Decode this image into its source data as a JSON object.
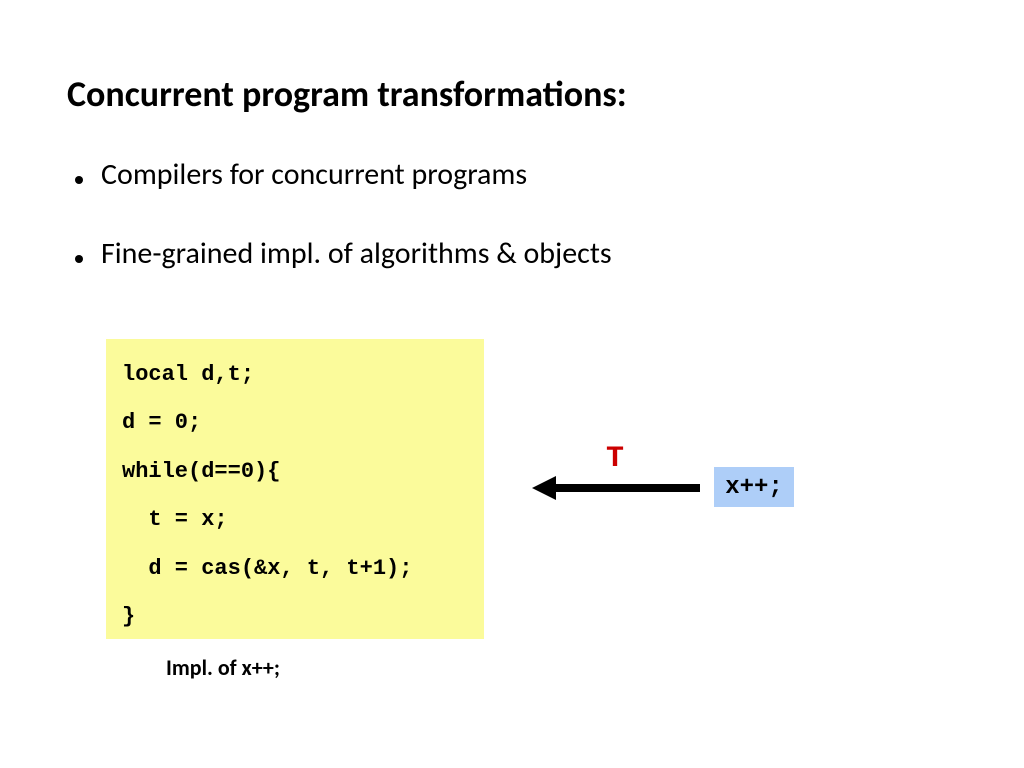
{
  "title": "Concurrent program transformations:",
  "bullets": [
    "Compilers for concurrent programs",
    "Fine-grained impl. of algorithms & objects"
  ],
  "code": {
    "l1": "local d,t;",
    "l2": "d = 0;",
    "l3": "while(d==0){",
    "l4": "  t = x;",
    "l5": "  d = cas(&x, t, t+1);",
    "l6": "}"
  },
  "caption": "Impl. of  x++;",
  "xbox_label": "x++;",
  "arrow_label": "T"
}
